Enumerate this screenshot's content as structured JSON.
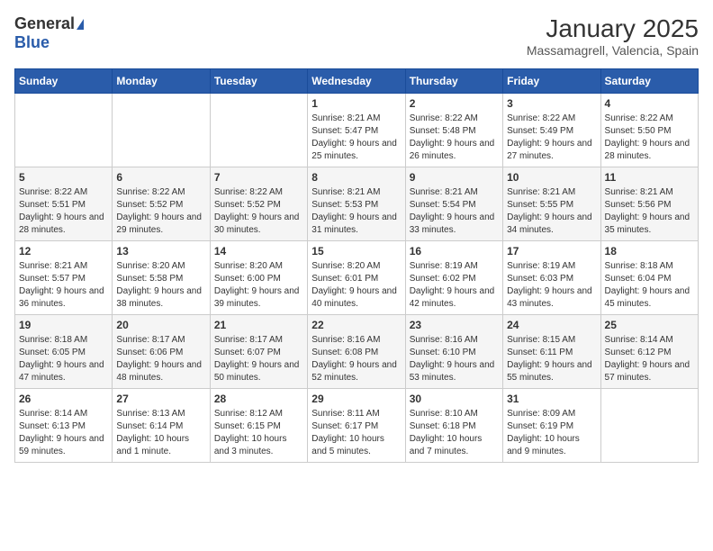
{
  "header": {
    "logo_general": "General",
    "logo_blue": "Blue",
    "month_title": "January 2025",
    "location": "Massamagrell, Valencia, Spain"
  },
  "days_of_week": [
    "Sunday",
    "Monday",
    "Tuesday",
    "Wednesday",
    "Thursday",
    "Friday",
    "Saturday"
  ],
  "weeks": [
    [
      {
        "day": "",
        "sunrise": "",
        "sunset": "",
        "daylight": ""
      },
      {
        "day": "",
        "sunrise": "",
        "sunset": "",
        "daylight": ""
      },
      {
        "day": "",
        "sunrise": "",
        "sunset": "",
        "daylight": ""
      },
      {
        "day": "1",
        "sunrise": "Sunrise: 8:21 AM",
        "sunset": "Sunset: 5:47 PM",
        "daylight": "Daylight: 9 hours and 25 minutes."
      },
      {
        "day": "2",
        "sunrise": "Sunrise: 8:22 AM",
        "sunset": "Sunset: 5:48 PM",
        "daylight": "Daylight: 9 hours and 26 minutes."
      },
      {
        "day": "3",
        "sunrise": "Sunrise: 8:22 AM",
        "sunset": "Sunset: 5:49 PM",
        "daylight": "Daylight: 9 hours and 27 minutes."
      },
      {
        "day": "4",
        "sunrise": "Sunrise: 8:22 AM",
        "sunset": "Sunset: 5:50 PM",
        "daylight": "Daylight: 9 hours and 28 minutes."
      }
    ],
    [
      {
        "day": "5",
        "sunrise": "Sunrise: 8:22 AM",
        "sunset": "Sunset: 5:51 PM",
        "daylight": "Daylight: 9 hours and 28 minutes."
      },
      {
        "day": "6",
        "sunrise": "Sunrise: 8:22 AM",
        "sunset": "Sunset: 5:52 PM",
        "daylight": "Daylight: 9 hours and 29 minutes."
      },
      {
        "day": "7",
        "sunrise": "Sunrise: 8:22 AM",
        "sunset": "Sunset: 5:52 PM",
        "daylight": "Daylight: 9 hours and 30 minutes."
      },
      {
        "day": "8",
        "sunrise": "Sunrise: 8:21 AM",
        "sunset": "Sunset: 5:53 PM",
        "daylight": "Daylight: 9 hours and 31 minutes."
      },
      {
        "day": "9",
        "sunrise": "Sunrise: 8:21 AM",
        "sunset": "Sunset: 5:54 PM",
        "daylight": "Daylight: 9 hours and 33 minutes."
      },
      {
        "day": "10",
        "sunrise": "Sunrise: 8:21 AM",
        "sunset": "Sunset: 5:55 PM",
        "daylight": "Daylight: 9 hours and 34 minutes."
      },
      {
        "day": "11",
        "sunrise": "Sunrise: 8:21 AM",
        "sunset": "Sunset: 5:56 PM",
        "daylight": "Daylight: 9 hours and 35 minutes."
      }
    ],
    [
      {
        "day": "12",
        "sunrise": "Sunrise: 8:21 AM",
        "sunset": "Sunset: 5:57 PM",
        "daylight": "Daylight: 9 hours and 36 minutes."
      },
      {
        "day": "13",
        "sunrise": "Sunrise: 8:20 AM",
        "sunset": "Sunset: 5:58 PM",
        "daylight": "Daylight: 9 hours and 38 minutes."
      },
      {
        "day": "14",
        "sunrise": "Sunrise: 8:20 AM",
        "sunset": "Sunset: 6:00 PM",
        "daylight": "Daylight: 9 hours and 39 minutes."
      },
      {
        "day": "15",
        "sunrise": "Sunrise: 8:20 AM",
        "sunset": "Sunset: 6:01 PM",
        "daylight": "Daylight: 9 hours and 40 minutes."
      },
      {
        "day": "16",
        "sunrise": "Sunrise: 8:19 AM",
        "sunset": "Sunset: 6:02 PM",
        "daylight": "Daylight: 9 hours and 42 minutes."
      },
      {
        "day": "17",
        "sunrise": "Sunrise: 8:19 AM",
        "sunset": "Sunset: 6:03 PM",
        "daylight": "Daylight: 9 hours and 43 minutes."
      },
      {
        "day": "18",
        "sunrise": "Sunrise: 8:18 AM",
        "sunset": "Sunset: 6:04 PM",
        "daylight": "Daylight: 9 hours and 45 minutes."
      }
    ],
    [
      {
        "day": "19",
        "sunrise": "Sunrise: 8:18 AM",
        "sunset": "Sunset: 6:05 PM",
        "daylight": "Daylight: 9 hours and 47 minutes."
      },
      {
        "day": "20",
        "sunrise": "Sunrise: 8:17 AM",
        "sunset": "Sunset: 6:06 PM",
        "daylight": "Daylight: 9 hours and 48 minutes."
      },
      {
        "day": "21",
        "sunrise": "Sunrise: 8:17 AM",
        "sunset": "Sunset: 6:07 PM",
        "daylight": "Daylight: 9 hours and 50 minutes."
      },
      {
        "day": "22",
        "sunrise": "Sunrise: 8:16 AM",
        "sunset": "Sunset: 6:08 PM",
        "daylight": "Daylight: 9 hours and 52 minutes."
      },
      {
        "day": "23",
        "sunrise": "Sunrise: 8:16 AM",
        "sunset": "Sunset: 6:10 PM",
        "daylight": "Daylight: 9 hours and 53 minutes."
      },
      {
        "day": "24",
        "sunrise": "Sunrise: 8:15 AM",
        "sunset": "Sunset: 6:11 PM",
        "daylight": "Daylight: 9 hours and 55 minutes."
      },
      {
        "day": "25",
        "sunrise": "Sunrise: 8:14 AM",
        "sunset": "Sunset: 6:12 PM",
        "daylight": "Daylight: 9 hours and 57 minutes."
      }
    ],
    [
      {
        "day": "26",
        "sunrise": "Sunrise: 8:14 AM",
        "sunset": "Sunset: 6:13 PM",
        "daylight": "Daylight: 9 hours and 59 minutes."
      },
      {
        "day": "27",
        "sunrise": "Sunrise: 8:13 AM",
        "sunset": "Sunset: 6:14 PM",
        "daylight": "Daylight: 10 hours and 1 minute."
      },
      {
        "day": "28",
        "sunrise": "Sunrise: 8:12 AM",
        "sunset": "Sunset: 6:15 PM",
        "daylight": "Daylight: 10 hours and 3 minutes."
      },
      {
        "day": "29",
        "sunrise": "Sunrise: 8:11 AM",
        "sunset": "Sunset: 6:17 PM",
        "daylight": "Daylight: 10 hours and 5 minutes."
      },
      {
        "day": "30",
        "sunrise": "Sunrise: 8:10 AM",
        "sunset": "Sunset: 6:18 PM",
        "daylight": "Daylight: 10 hours and 7 minutes."
      },
      {
        "day": "31",
        "sunrise": "Sunrise: 8:09 AM",
        "sunset": "Sunset: 6:19 PM",
        "daylight": "Daylight: 10 hours and 9 minutes."
      },
      {
        "day": "",
        "sunrise": "",
        "sunset": "",
        "daylight": ""
      }
    ]
  ]
}
